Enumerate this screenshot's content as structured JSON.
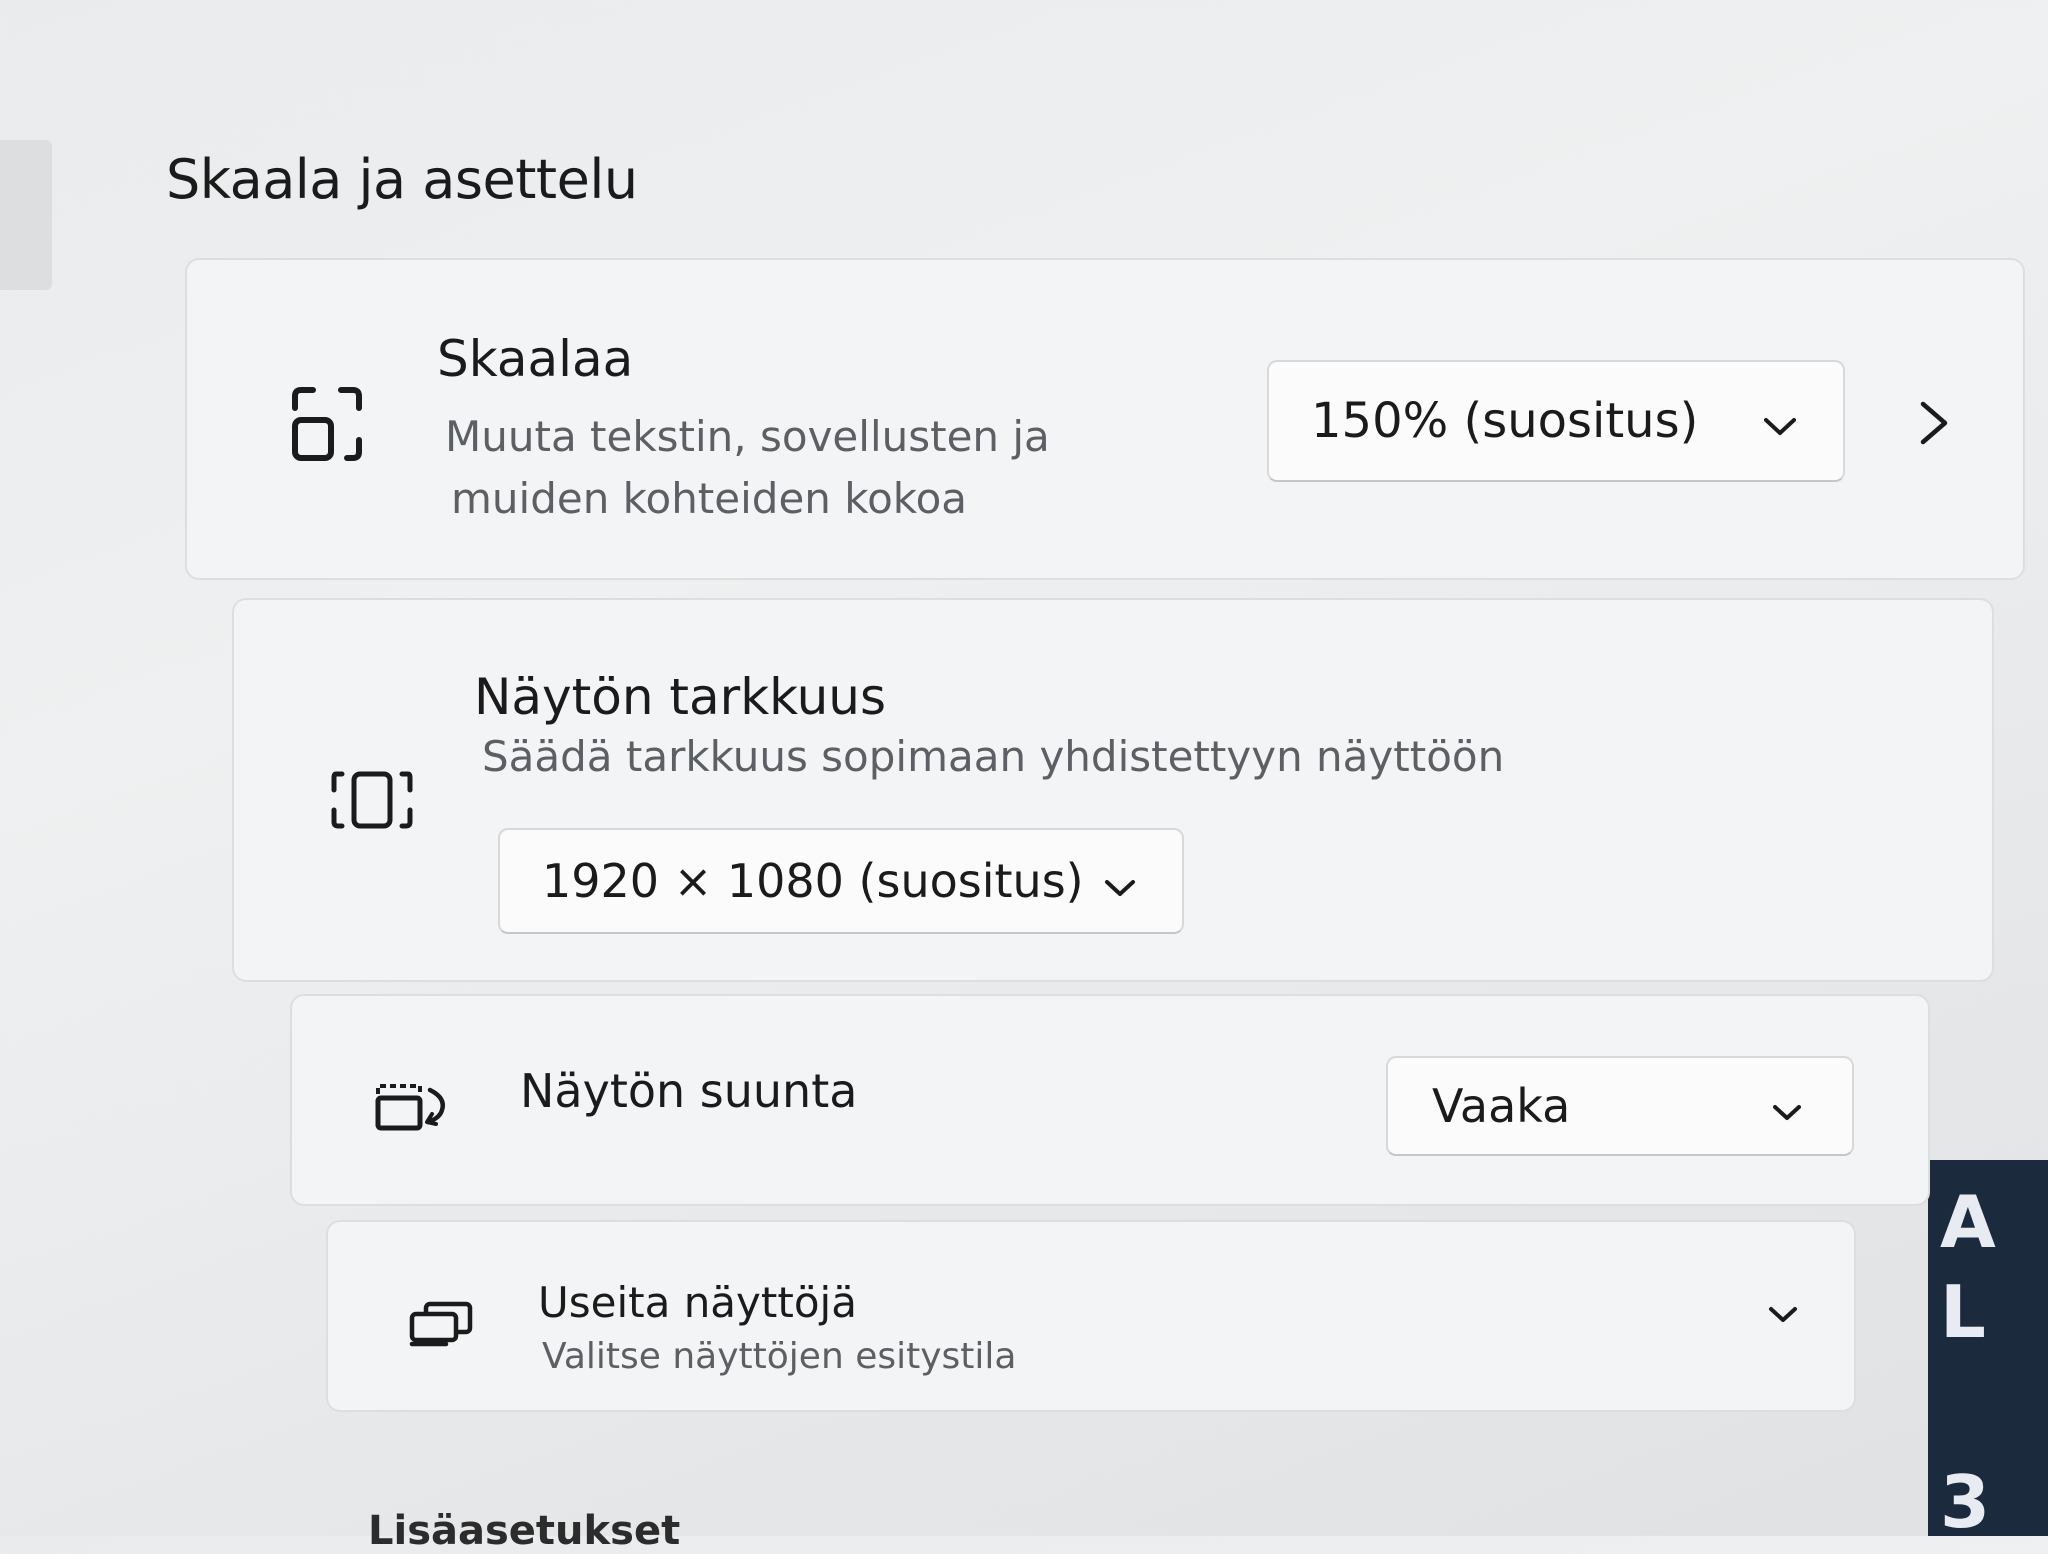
{
  "section_title": "Skaala ja asettelu",
  "scale": {
    "title": "Skaalaa",
    "description_line1": "Muuta tekstin, sovellusten ja",
    "description_line2": "muiden kohteiden kokoa",
    "selected": "150% (suositus)",
    "icon": "scale-icon",
    "chevron_right_icon": "chevron-right-icon"
  },
  "resolution": {
    "title": "Näytön tarkkuus",
    "description": "Säädä tarkkuus sopimaan yhdistettyyn näyttöön",
    "selected": "1920 × 1080 (suositus)",
    "icon": "resolution-icon"
  },
  "orientation": {
    "title": "Näytön suunta",
    "selected": "Vaaka",
    "icon": "orientation-icon"
  },
  "multiple_displays": {
    "title": "Useita näyttöjä",
    "description": "Valitse näyttöjen esitystila",
    "icon": "multiple-displays-icon"
  },
  "next_section_partial": "Lisäasetukset"
}
